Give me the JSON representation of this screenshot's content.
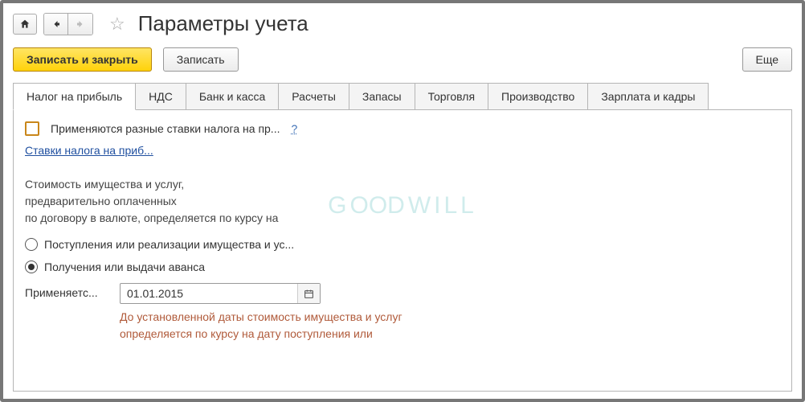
{
  "header": {
    "title": "Параметры учета"
  },
  "toolbar": {
    "save_close_label": "Записать и закрыть",
    "save_label": "Записать",
    "more_label": "Еще"
  },
  "tabs": [
    {
      "label": "Налог на прибыль",
      "active": true
    },
    {
      "label": "НДС"
    },
    {
      "label": "Банк и касса"
    },
    {
      "label": "Расчеты"
    },
    {
      "label": "Запасы"
    },
    {
      "label": "Торговля"
    },
    {
      "label": "Производство"
    },
    {
      "label": "Зарплата и кадры"
    }
  ],
  "panel": {
    "checkbox_label": "Применяются разные ставки налога на пр...",
    "help_symbol": "?",
    "rates_link": "Ставки налога на приб...",
    "info_line1": "Стоимость имущества и услуг,",
    "info_line2": "предварительно оплаченных",
    "info_line3": "по договору в валюте, определяется по курсу на",
    "radio_option1": "Поступления или реализации имущества и ус...",
    "radio_option2": "Получения или выдачи аванса",
    "applies_label": "Применяетс...",
    "date_value": "01.01.2015",
    "hint_line1": "До установленной даты стоимость имущества и услуг",
    "hint_line2": "определяется по курсу на дату поступления или"
  },
  "watermark": "GOODWILL"
}
